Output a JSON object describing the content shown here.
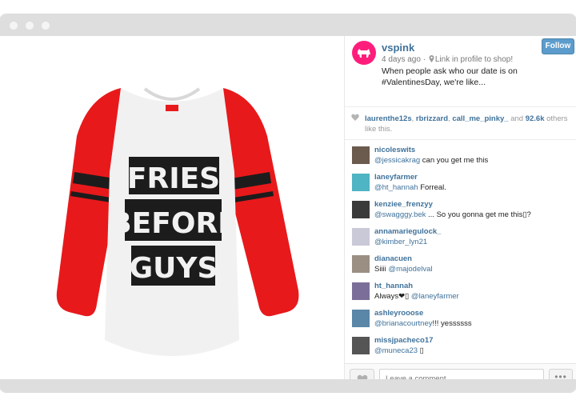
{
  "post": {
    "username": "vspink",
    "time": "4 days ago",
    "separator": "·",
    "location": "Link in profile to shop!",
    "caption": "When people ask who our date is on #ValentinesDay, we're like...",
    "follow_label": "Follow"
  },
  "photo": {
    "shirt_lines": [
      "FRIES",
      "BEFORE",
      "GUYS"
    ],
    "colors": {
      "sleeve": "#e8191b",
      "body": "#f1f1f1",
      "print": "#1c1c1c"
    }
  },
  "likes": {
    "users": [
      "laurenthe12s",
      "rbrizzard",
      "call_me_pinky_"
    ],
    "count": "92.6k",
    "and_text": "and",
    "suffix": "others like this.",
    "sep1": ", ",
    "sep2": ", "
  },
  "comments": [
    {
      "user": "nicoleswits",
      "mention": "@jessicakrag",
      "text": " can you get me this",
      "avatar": "#6b5a4e"
    },
    {
      "user": "laneyfarmer",
      "mention": "@ht_hannah",
      "text": " Forreal.",
      "avatar": "#4fb4c3"
    },
    {
      "user": "kenziee_frenzyy",
      "mention": "@swagggy.bek",
      "text": " ... So you gonna get me this▯?",
      "avatar": "#3a3a3a"
    },
    {
      "user": "annamariegulock_",
      "mention": "@kimber_lyn21",
      "text": "",
      "avatar": "#c9c9d8"
    },
    {
      "user": "dianacuen",
      "prefix": "Siiii ",
      "mention": "@majodelval",
      "text": "",
      "avatar": "#9a8f82"
    },
    {
      "user": "ht_hannah",
      "prefix": "Always❤▯ ",
      "mention": "@laneyfarmer",
      "text": "",
      "avatar": "#7b6f99"
    },
    {
      "user": "ashleyrooose",
      "mention": "@brianacourtney",
      "text": "!!! yessssss",
      "avatar": "#5a86a8"
    },
    {
      "user": "missjpacheco17",
      "mention": "@muneca23",
      "text": " ▯",
      "avatar": "#555555"
    }
  ],
  "footer": {
    "comment_placeholder": "Leave a comment...",
    "more_label": "•••"
  },
  "accent": {
    "link": "#3f729b",
    "brand": "#ff1d7c",
    "follow": "#5c9ccc"
  }
}
